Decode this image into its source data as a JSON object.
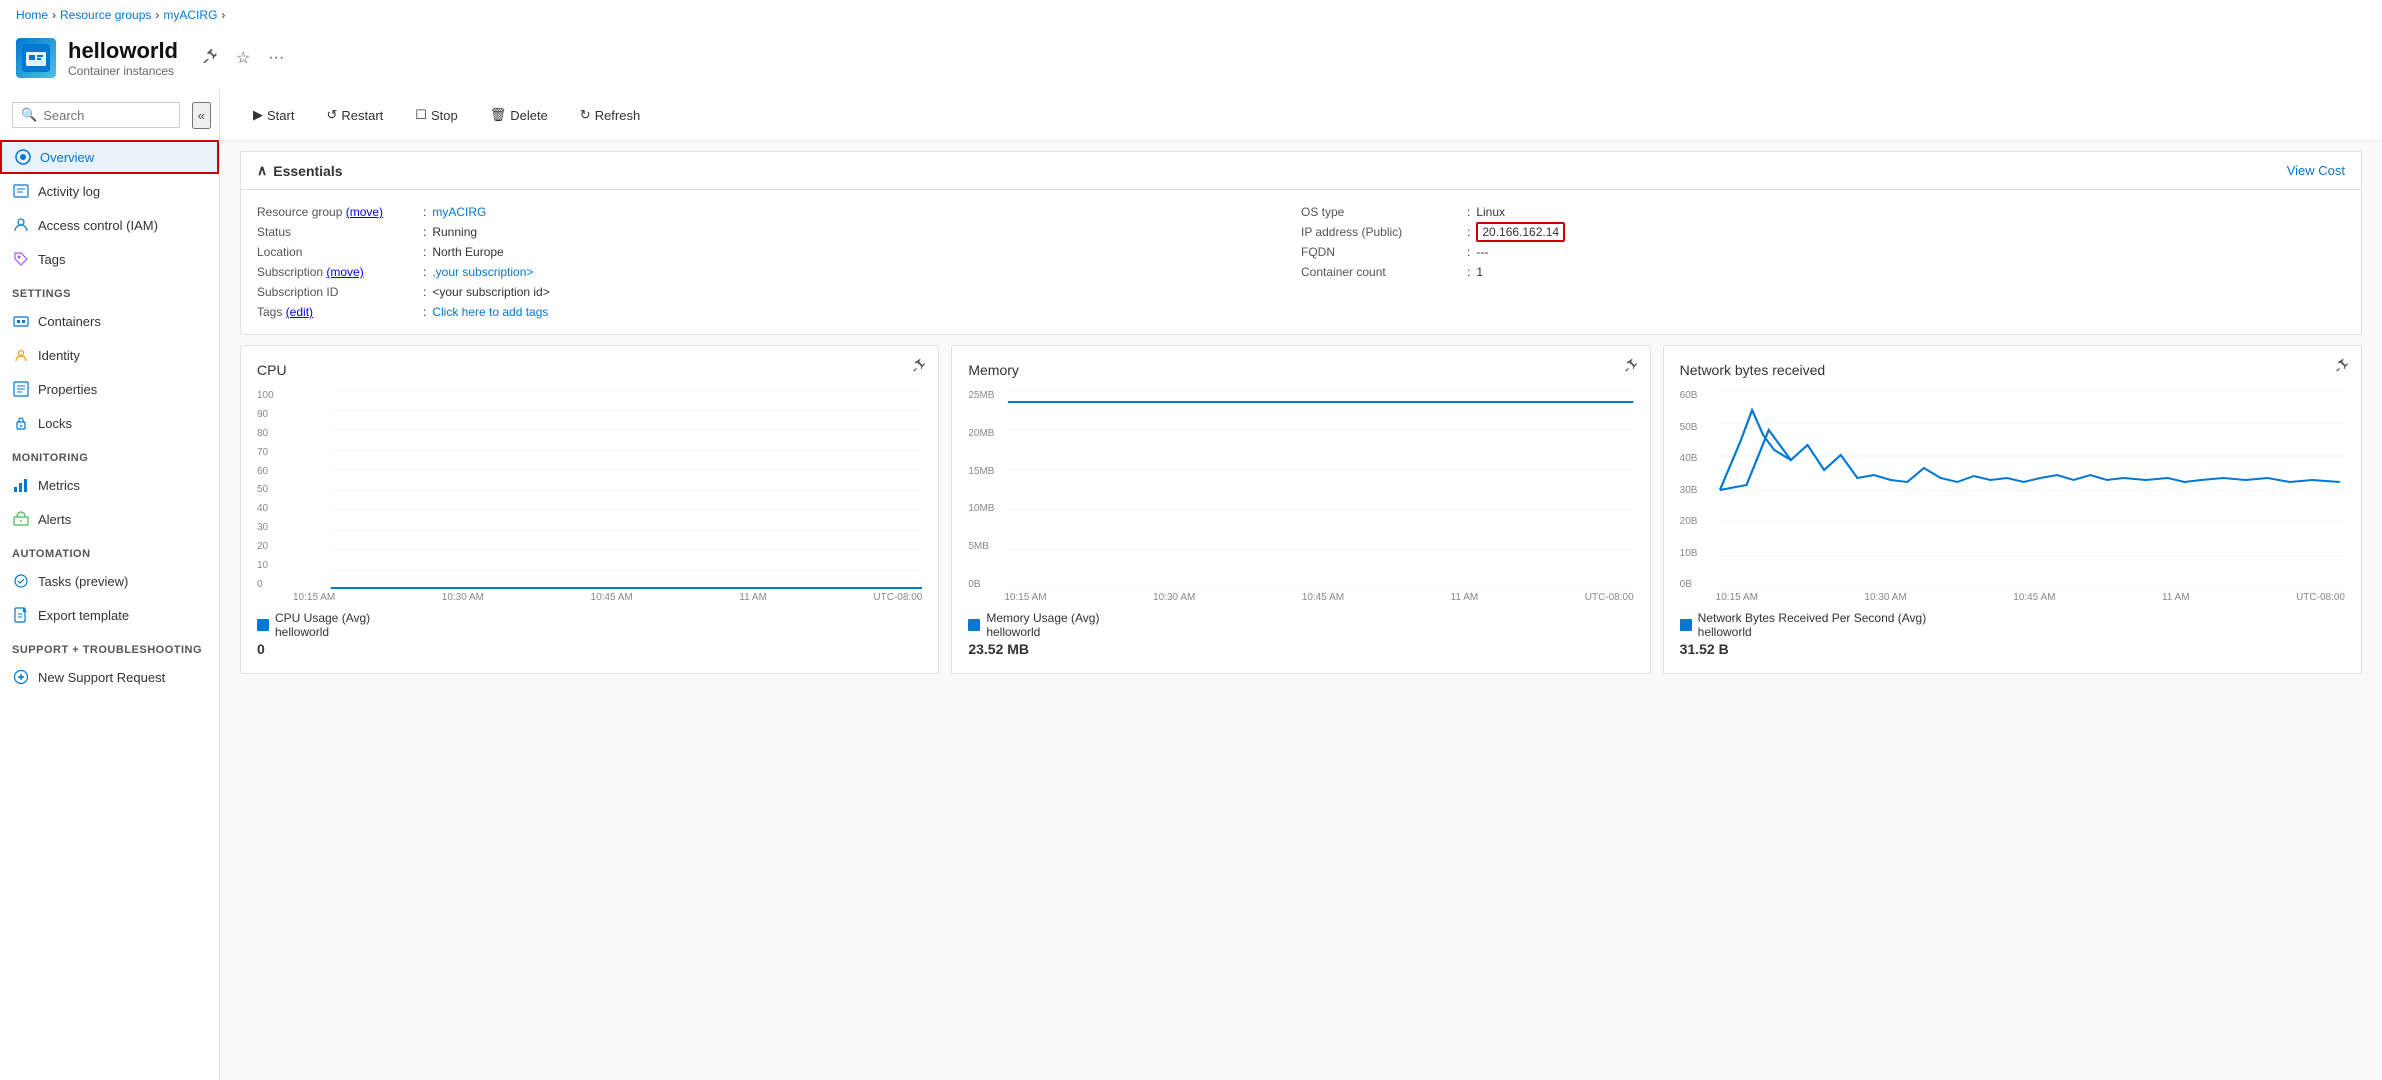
{
  "breadcrumb": {
    "items": [
      "Home",
      "Resource groups",
      "myACIRG"
    ]
  },
  "header": {
    "title": "helloworld",
    "subtitle": "Container instances",
    "icon": "🐳"
  },
  "toolbar": {
    "buttons": [
      {
        "label": "Start",
        "icon": "▶"
      },
      {
        "label": "Restart",
        "icon": "↺"
      },
      {
        "label": "Stop",
        "icon": "□"
      },
      {
        "label": "Delete",
        "icon": "🗑"
      },
      {
        "label": "Refresh",
        "icon": "↻"
      }
    ]
  },
  "essentials": {
    "header": "Essentials",
    "viewCost": "View Cost",
    "fields_left": [
      {
        "label": "Resource group (move)",
        "value": "myACIRG",
        "link": true,
        "move_link": true
      },
      {
        "label": "Status",
        "value": "Running"
      },
      {
        "label": "Location",
        "value": "North Europe"
      },
      {
        "label": "Subscription (move)",
        "value": ",your subscription>",
        "link": true
      },
      {
        "label": "Subscription ID",
        "value": "<your subscription id>"
      },
      {
        "label": "Tags (edit)",
        "value": "Click here to add tags",
        "link": true
      }
    ],
    "fields_right": [
      {
        "label": "OS type",
        "value": "Linux"
      },
      {
        "label": "IP address (Public)",
        "value": "20.166.162.14",
        "highlight": true
      },
      {
        "label": "FQDN",
        "value": "---"
      },
      {
        "label": "Container count",
        "value": "1"
      }
    ]
  },
  "sidebar": {
    "search_placeholder": "Search",
    "nav_items": [
      {
        "label": "Overview",
        "icon": "🌐",
        "active": true,
        "section": null
      },
      {
        "label": "Activity log",
        "icon": "📋",
        "active": false,
        "section": null
      },
      {
        "label": "Access control (IAM)",
        "icon": "👤",
        "active": false,
        "section": null
      },
      {
        "label": "Tags",
        "icon": "🏷",
        "active": false,
        "section": null
      },
      {
        "label": "Settings",
        "section_label": true
      },
      {
        "label": "Containers",
        "icon": "📦",
        "active": false,
        "section": "Settings"
      },
      {
        "label": "Identity",
        "icon": "🔑",
        "active": false,
        "section": "Settings"
      },
      {
        "label": "Properties",
        "icon": "📊",
        "active": false,
        "section": "Settings"
      },
      {
        "label": "Locks",
        "icon": "🔒",
        "active": false,
        "section": "Settings"
      },
      {
        "label": "Monitoring",
        "section_label": true
      },
      {
        "label": "Metrics",
        "icon": "📈",
        "active": false,
        "section": "Monitoring"
      },
      {
        "label": "Alerts",
        "icon": "🔔",
        "active": false,
        "section": "Monitoring"
      },
      {
        "label": "Automation",
        "section_label": true
      },
      {
        "label": "Tasks (preview)",
        "icon": "⚙",
        "active": false,
        "section": "Automation"
      },
      {
        "label": "Export template",
        "icon": "📤",
        "active": false,
        "section": "Automation"
      },
      {
        "label": "Support + troubleshooting",
        "section_label": true
      },
      {
        "label": "New Support Request",
        "icon": "➕",
        "active": false,
        "section": "Support"
      }
    ]
  },
  "charts": [
    {
      "title": "CPU",
      "pin_icon": "📌",
      "legend_label": "CPU Usage (Avg)",
      "legend_sub": "helloworld",
      "value": "0",
      "x_labels": [
        "10:15 AM",
        "10:30 AM",
        "10:45 AM",
        "11 AM",
        "UTC-08:00"
      ],
      "y_labels": [
        "100",
        "90",
        "80",
        "70",
        "60",
        "50",
        "40",
        "30",
        "20",
        "10",
        "0"
      ],
      "type": "flat"
    },
    {
      "title": "Memory",
      "pin_icon": "📌",
      "legend_label": "Memory Usage (Avg)",
      "legend_sub": "helloworld",
      "value": "23.52 MB",
      "x_labels": [
        "10:15 AM",
        "10:30 AM",
        "10:45 AM",
        "11 AM",
        "UTC-08:00"
      ],
      "y_labels": [
        "25MB",
        "20MB",
        "15MB",
        "10MB",
        "5MB",
        "0B"
      ],
      "type": "memory"
    },
    {
      "title": "Network bytes received",
      "pin_icon": "📌",
      "legend_label": "Network Bytes Received Per Second (Avg)",
      "legend_sub": "helloworld",
      "value": "31.52 B",
      "x_labels": [
        "10:15 AM",
        "10:30 AM",
        "10:45 AM",
        "11 AM",
        "UTC-08:00"
      ],
      "y_labels": [
        "60B",
        "50B",
        "40B",
        "30B",
        "20B",
        "10B",
        "0B"
      ],
      "type": "network"
    }
  ]
}
